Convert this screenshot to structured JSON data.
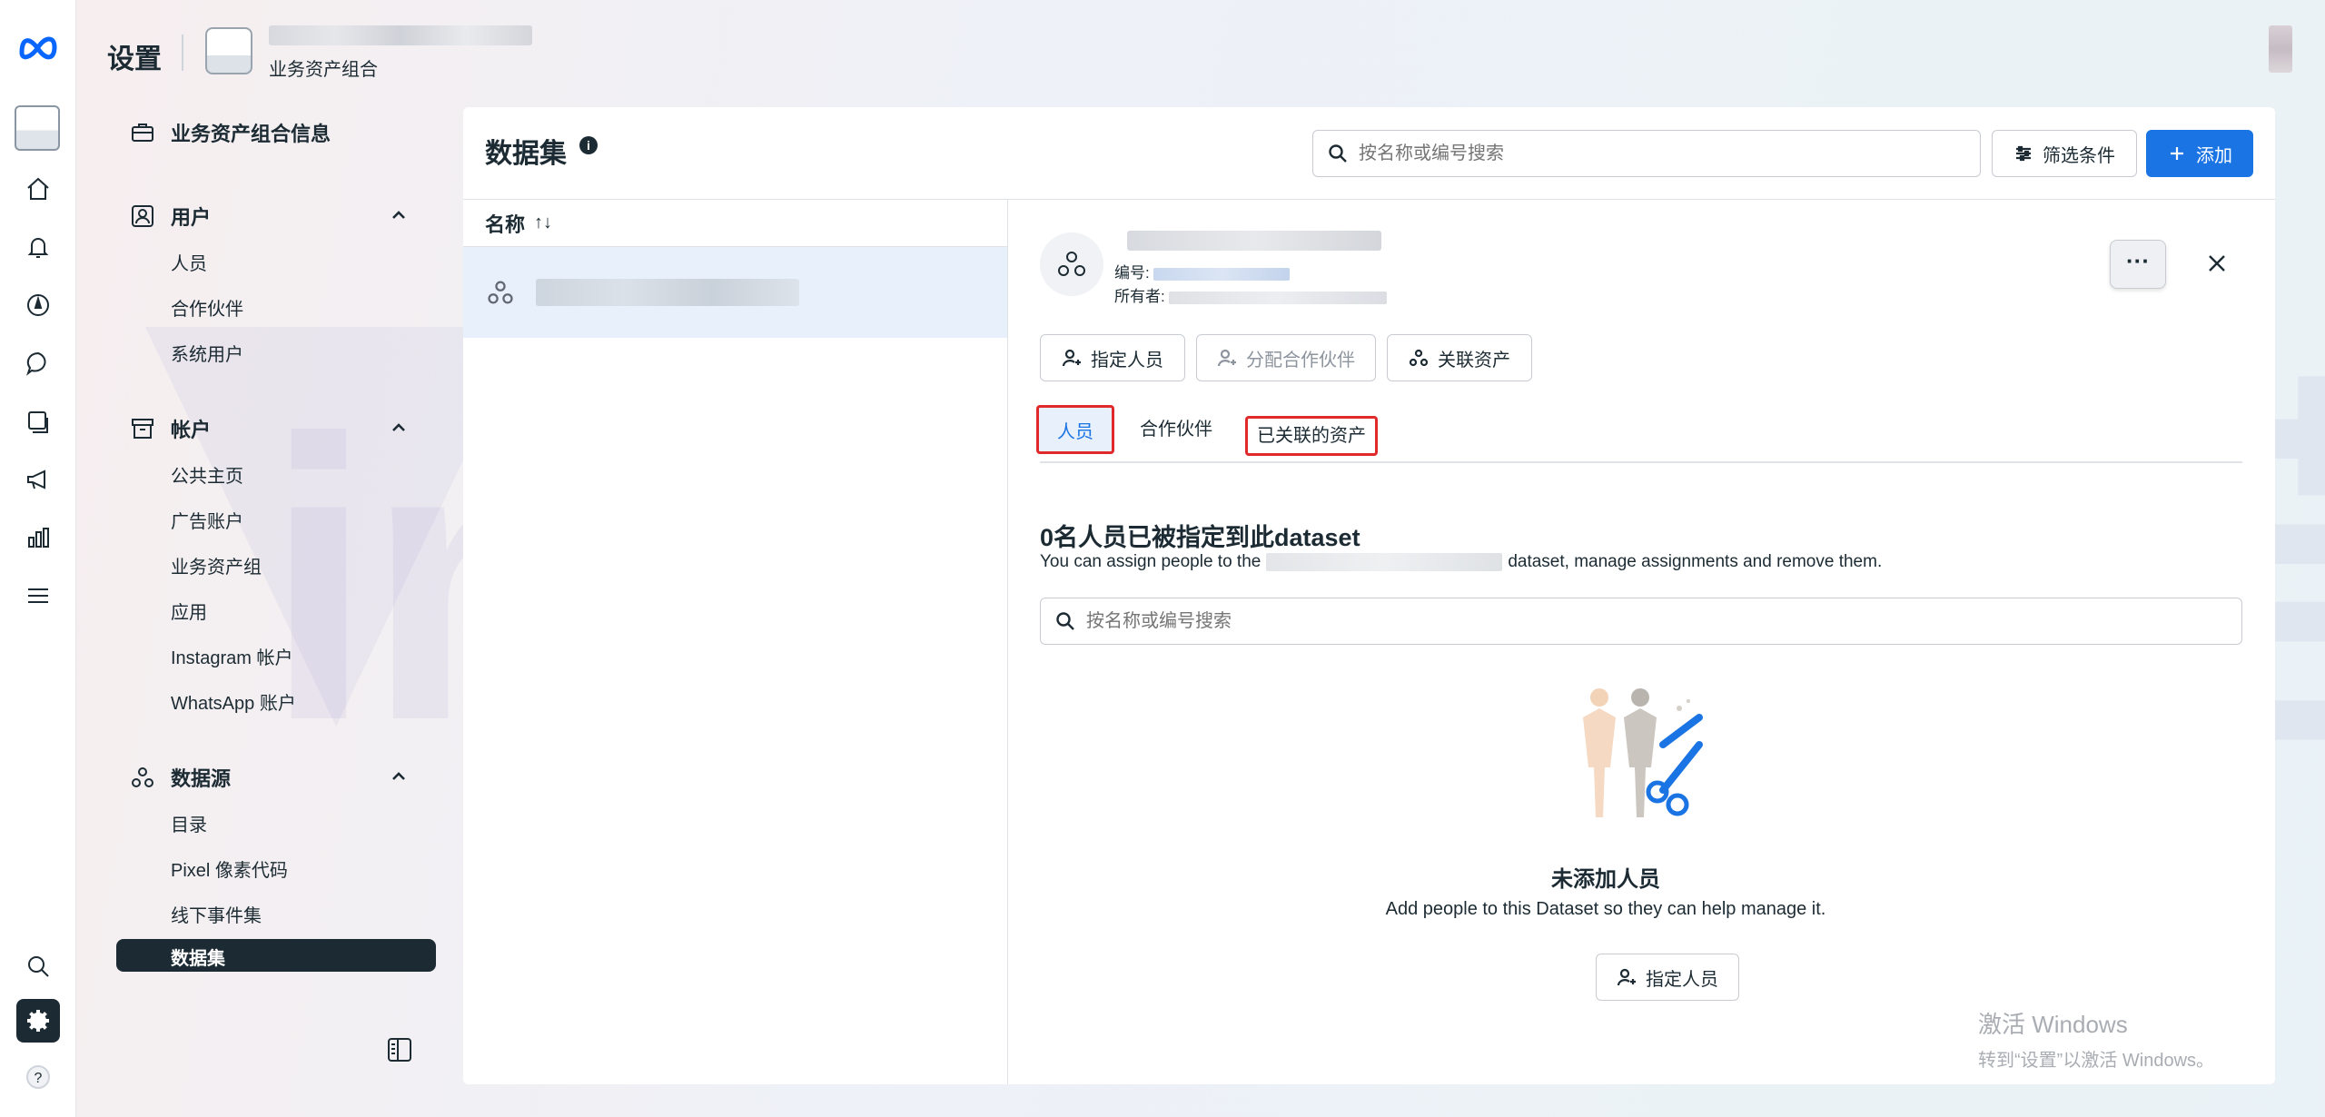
{
  "header": {
    "title": "设置",
    "portfolio_subtitle": "业务资产组合"
  },
  "sidebar": {
    "portfolio_info": "业务资产组合信息",
    "groups": [
      {
        "label": "用户",
        "items": [
          "人员",
          "合作伙伴",
          "系统用户"
        ]
      },
      {
        "label": "帐户",
        "items": [
          "公共主页",
          "广告账户",
          "业务资产组",
          "应用",
          "Instagram 帐户",
          "WhatsApp 账户"
        ]
      },
      {
        "label": "数据源",
        "items": [
          "目录",
          "Pixel 像素代码",
          "线下事件集",
          "数据集"
        ]
      }
    ]
  },
  "main": {
    "title": "数据集",
    "search_placeholder": "按名称或编号搜索",
    "filter_label": "筛选条件",
    "add_label": "添加",
    "list_header": "名称",
    "sort_glyph": "↑↓"
  },
  "detail": {
    "id_label": "编号:",
    "owner_label": "所有者:",
    "owner_prefix": "",
    "more_glyph": "···",
    "actions": {
      "assign_people": "指定人员",
      "assign_partner": "分配合作伙伴",
      "linked_assets": "关联资产"
    },
    "tabs": [
      "人员",
      "合作伙伴",
      "已关联的资产"
    ],
    "section_title": "0名人员已被指定到此dataset",
    "section_desc_pre": "You can assign people to the",
    "section_desc_post": "dataset, manage assignments and remove them.",
    "search_placeholder": "按名称或编号搜索",
    "empty_title": "未添加人员",
    "empty_desc": "Add people to this Dataset so they can help manage it.",
    "empty_button": "指定人员"
  },
  "watermark": {
    "text": "inoLink易诺"
  },
  "windows_activation": {
    "line1": "激活 Windows",
    "line2": "转到“设置”以激活 Windows。"
  },
  "colors": {
    "primary": "#1b74e4",
    "text": "#1c2b33",
    "selected_row": "#e7f0fb",
    "highlight_outline": "#e02a2a"
  }
}
